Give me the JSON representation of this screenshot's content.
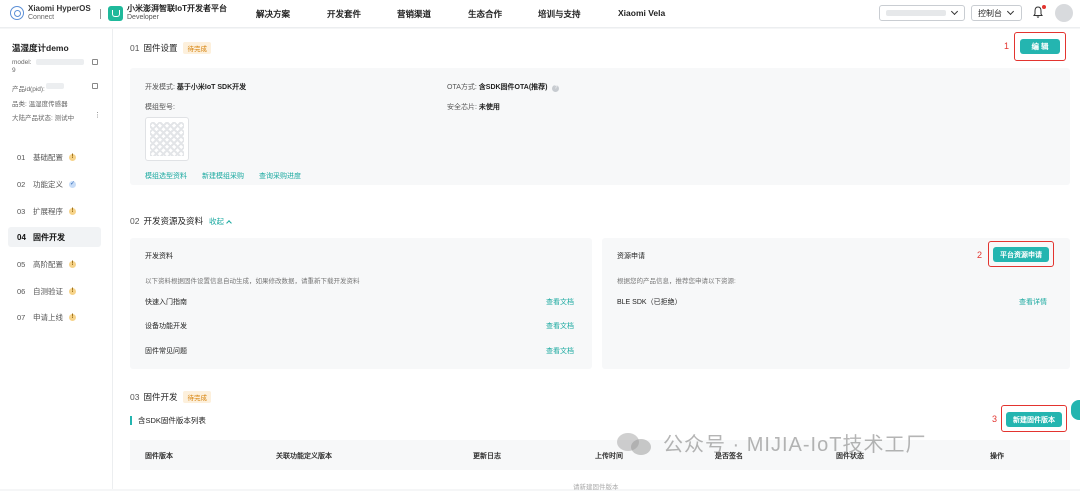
{
  "header": {
    "brand_line1": "Xiaomi HyperOS",
    "brand_line2": "Connect",
    "platform_line1": "小米澎湃智联IoT开发者平台",
    "platform_line2": "Developer",
    "nav": [
      "解决方案",
      "开发套件",
      "营销渠道",
      "生态合作",
      "培训与支持",
      "Xiaomi Vela"
    ],
    "console_label": "控制台"
  },
  "sidebar": {
    "product_name": "温湿度计demo",
    "model_label": "model:",
    "model_suffix": "9",
    "pid_label": "产品id(pid):",
    "category": "品类: 温湿度传感器",
    "status": "大陆产品状态: 测试中",
    "more": "⋮",
    "steps": [
      {
        "num": "01",
        "label": "基础配置",
        "state": "warn"
      },
      {
        "num": "02",
        "label": "功能定义",
        "state": "ok"
      },
      {
        "num": "03",
        "label": "扩展程序",
        "state": "warn"
      },
      {
        "num": "04",
        "label": "固件开发",
        "state": "active"
      },
      {
        "num": "05",
        "label": "高阶配置",
        "state": "warn"
      },
      {
        "num": "06",
        "label": "自测验证",
        "state": "warn"
      },
      {
        "num": "07",
        "label": "申请上线",
        "state": "warn"
      }
    ],
    "badge_warn_glyph": "!",
    "badge_ok_glyph": "✓"
  },
  "section1": {
    "num": "01",
    "title": "固件设置",
    "tag": "待完成",
    "edit_button": "编 辑",
    "dev_mode_label": "开发模式:",
    "dev_mode_value": "基于小米IoT SDK开发",
    "ota_label": "OTA方式:",
    "ota_value": "含SDK固件OTA(推荐)",
    "module_label": "模组型号:",
    "chip_label": "安全芯片:",
    "chip_value": "未使用",
    "links": [
      "模组选型资料",
      "新建模组采购",
      "查询采购进度"
    ]
  },
  "section2": {
    "num": "02",
    "title": "开发资源及资料",
    "collapse_label": "收起",
    "left_title": "开发资料",
    "left_desc": "以下资料根据固件设置信息自动生成，如果修改数据，请重新下载开发资料",
    "docs": [
      {
        "name": "快速入门指南",
        "action": "查看文档"
      },
      {
        "name": "设备功能开发",
        "action": "查看文档"
      },
      {
        "name": "固件常见问题",
        "action": "查看文档"
      }
    ],
    "right_title": "资源申请",
    "right_desc": "根据您的产品信息，推荐您申请以下资源:",
    "apply_button": "平台资源申请",
    "resource_name": "BLE SDK（已拒绝）",
    "resource_action": "查看详情"
  },
  "section3": {
    "num": "03",
    "title": "固件开发",
    "tag": "待完成",
    "list_title": "含SDK固件版本列表",
    "new_button": "新建固件版本",
    "columns": [
      "固件版本",
      "关联功能定义版本",
      "更新日志",
      "上传时间",
      "是否签名",
      "固件状态",
      "操作"
    ],
    "empty_text": "请新建固件版本"
  },
  "annotations": [
    "1",
    "2",
    "3"
  ],
  "watermark": "公众号 · MIJIA-IoT技术工厂",
  "colors": {
    "accent": "#24b5b0",
    "link": "#1aa9a0",
    "highlight": "#e3342f",
    "pending_bg": "#fdf0dc",
    "pending_fg": "#d6820a"
  }
}
